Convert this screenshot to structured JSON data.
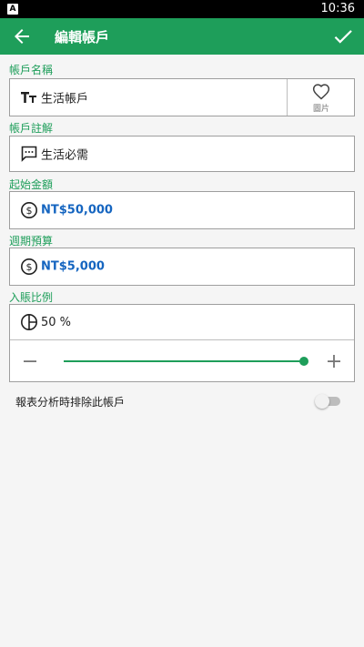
{
  "status_bar": {
    "app_badge": "A",
    "time": "10:36"
  },
  "app_bar": {
    "title": "編輯帳戶",
    "back_icon": "arrow-left-icon",
    "confirm_icon": "checkmark-icon"
  },
  "colors": {
    "accent": "#1e9e5a",
    "amount_text": "#1565c0"
  },
  "account_name": {
    "label": "帳戶名稱",
    "value": "生活帳戶",
    "icon": "text-size-icon",
    "image_button": {
      "icon": "heart-icon",
      "caption": "圖片"
    }
  },
  "account_note": {
    "label": "帳戶註解",
    "value": "生活必需",
    "icon": "comment-icon"
  },
  "initial_amount": {
    "label": "起始金額",
    "value": "NT$50,000",
    "icon": "dollar-icon"
  },
  "period_budget": {
    "label": "週期預算",
    "value": "NT$5,000",
    "icon": "dollar-icon"
  },
  "income_ratio": {
    "label": "入賬比例",
    "value_text": "50 %",
    "icon": "pie-chart-icon",
    "slider_value": 1.0
  },
  "exclude_from_reports": {
    "label": "報表分析時排除此帳戶",
    "enabled": false
  }
}
